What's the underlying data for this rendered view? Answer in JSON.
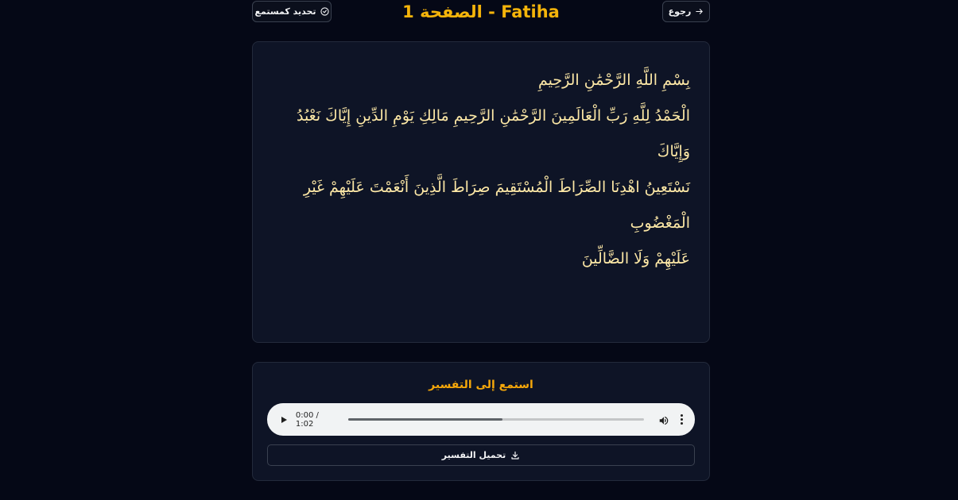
{
  "header": {
    "back_label": "رجوع",
    "title": "الصفحة 1 - Fatiha",
    "mark_listener_label": "تحديد كمستمع"
  },
  "ayah_text": {
    "line1": "بِسْمِ اللَّهِ الرَّحْمَٰنِ الرَّحِيمِ",
    "line2": "الْحَمْدُ لِلَّهِ رَبِّ الْعَالَمِينَ الرَّحْمَٰنِ الرَّحِيمِ مَالِكِ يَوْمِ الدِّينِ إِيَّاكَ نَعْبُدُ وَإِيَّاكَ",
    "line3": "نَسْتَعِينُ اهْدِنَا الصِّرَاطَ الْمُسْتَقِيمَ صِرَاطَ الَّذِينَ أَنْعَمْتَ عَلَيْهِمْ غَيْرِ الْمَغْضُوبِ",
    "line4": "عَلَيْهِمْ وَلَا الضَّالِّينَ"
  },
  "tafsir": {
    "title": "استمع إلى التفسير",
    "player": {
      "time_display": "0:00 / 1:02",
      "progress_fraction": 0.52
    },
    "download_label": "تحميل التفسير"
  },
  "colors": {
    "accent": "#f5b40a",
    "background": "#050816",
    "card": "#0e1426",
    "ayah_text": "#fde8a6"
  }
}
